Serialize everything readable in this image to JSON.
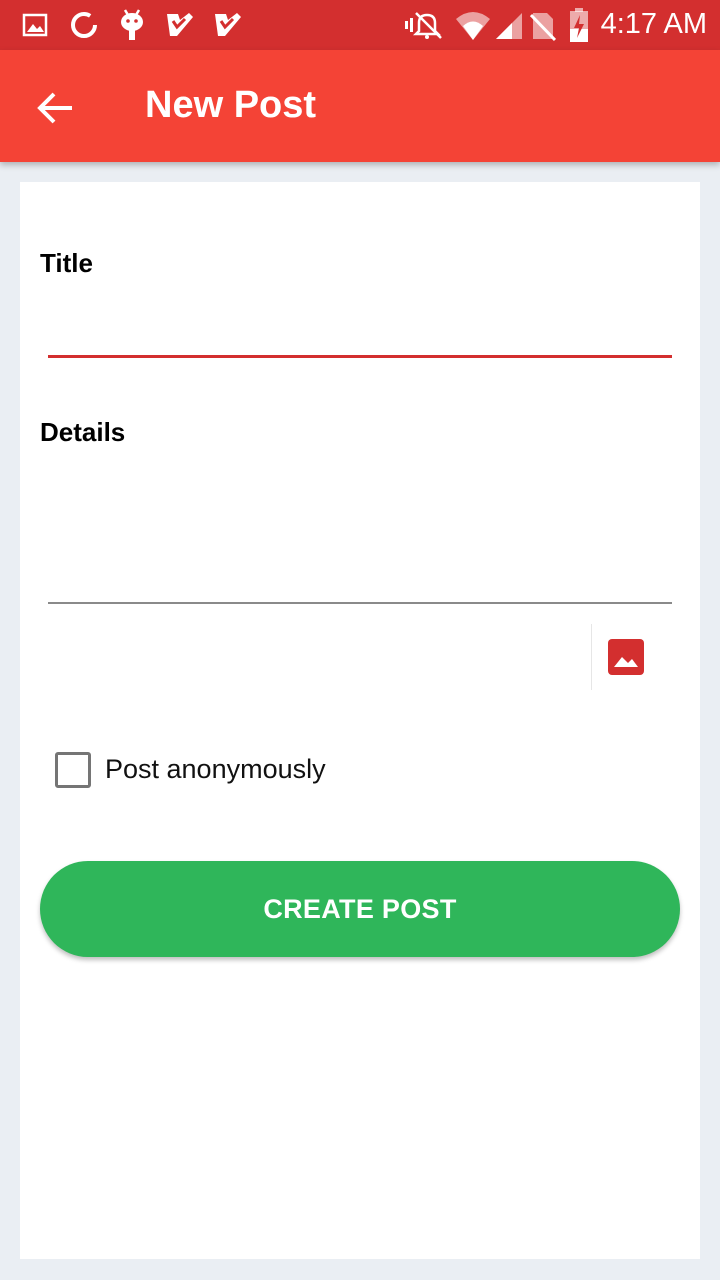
{
  "status_bar": {
    "time": "4:17 AM",
    "icons": [
      "image-notification-icon",
      "sync-circle-icon",
      "android-icon",
      "checkmark-app-icon",
      "checkmark-app-icon",
      "vibrate-alarm-off-icon",
      "wifi-icon",
      "cell-signal-icon",
      "no-sim-icon",
      "battery-charging-icon"
    ]
  },
  "app_bar": {
    "title": "New Post",
    "back_icon": "arrow-back-icon",
    "color": "#f44336"
  },
  "form": {
    "title_label": "Title",
    "title_value": "",
    "details_label": "Details",
    "details_value": "",
    "image_icon": "image-icon",
    "anonymous_label": "Post anonymously",
    "anonymous_checked": false,
    "submit_label": "CREATE POST",
    "submit_color": "#2fb65a",
    "accent_color": "#d32f2f"
  }
}
